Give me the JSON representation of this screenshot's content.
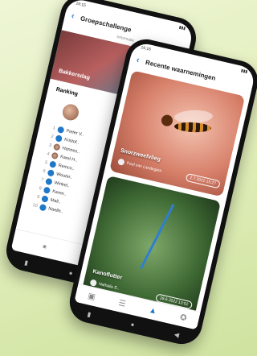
{
  "back_phone": {
    "title": "Groepschallenge",
    "top_icon_label": "Informatie",
    "hero_title": "Bakkersdag",
    "section": "Ranking",
    "ranking": [
      {
        "rank": "1",
        "name": "Pieter V.."
      },
      {
        "rank": "2",
        "name": "Kristof.."
      },
      {
        "rank": "3",
        "name": "Hannes.."
      },
      {
        "rank": "4",
        "name": "Karel H.."
      },
      {
        "rank": "5",
        "name": "Remco.."
      },
      {
        "rank": "6",
        "name": "Wouter.."
      },
      {
        "rank": "7",
        "name": "Winkel.."
      },
      {
        "rank": "8",
        "name": "Karen.."
      },
      {
        "rank": "9",
        "name": "Mall.."
      },
      {
        "rank": "10",
        "name": "Naelle.."
      }
    ]
  },
  "front_phone": {
    "title": "Recente waarnemingen",
    "cards": [
      {
        "name": "Snorzweefvlieg",
        "user": "Paul van Landegem",
        "date": "2.7.2022 15:27"
      },
      {
        "name": "Kanoflutter",
        "user": "Nathalie E..",
        "date": "28.6.2022 13:52"
      }
    ],
    "tabs": [
      "camera",
      "list",
      "map",
      "badge"
    ]
  }
}
